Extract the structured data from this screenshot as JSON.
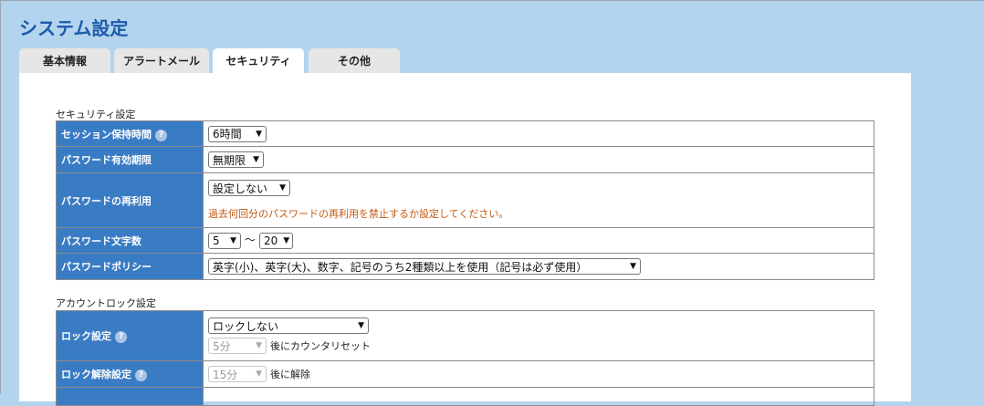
{
  "page_title": "システム設定",
  "tabs": [
    "基本情報",
    "アラートメール",
    "セキュリティ",
    "その他"
  ],
  "security": {
    "section_title": "セキュリティ設定",
    "session": {
      "label": "セッション保持時間",
      "help": "?",
      "value": "6時間"
    },
    "pw_expiry": {
      "label": "パスワード有効期限",
      "value": "無期限"
    },
    "pw_reuse": {
      "label": "パスワードの再利用",
      "value": "設定しない",
      "note": "過去何回分のパスワードの再利用を禁止するか設定してください。"
    },
    "pw_length": {
      "label": "パスワード文字数",
      "min": "5",
      "separator": "〜",
      "max": "20"
    },
    "pw_policy": {
      "label": "パスワードポリシー",
      "value": "英字(小)、英字(大)、数字、記号のうち2種類以上を使用（記号は必ず使用）"
    }
  },
  "account_lock": {
    "section_title": "アカウントロック設定",
    "lock": {
      "label": "ロック設定",
      "help": "?",
      "value": "ロックしない",
      "reset_value": "5分",
      "reset_suffix": "後にカウンタリセット"
    },
    "unlock": {
      "label": "ロック解除設定",
      "help": "?",
      "value": "15分",
      "suffix": "後に解除"
    }
  }
}
